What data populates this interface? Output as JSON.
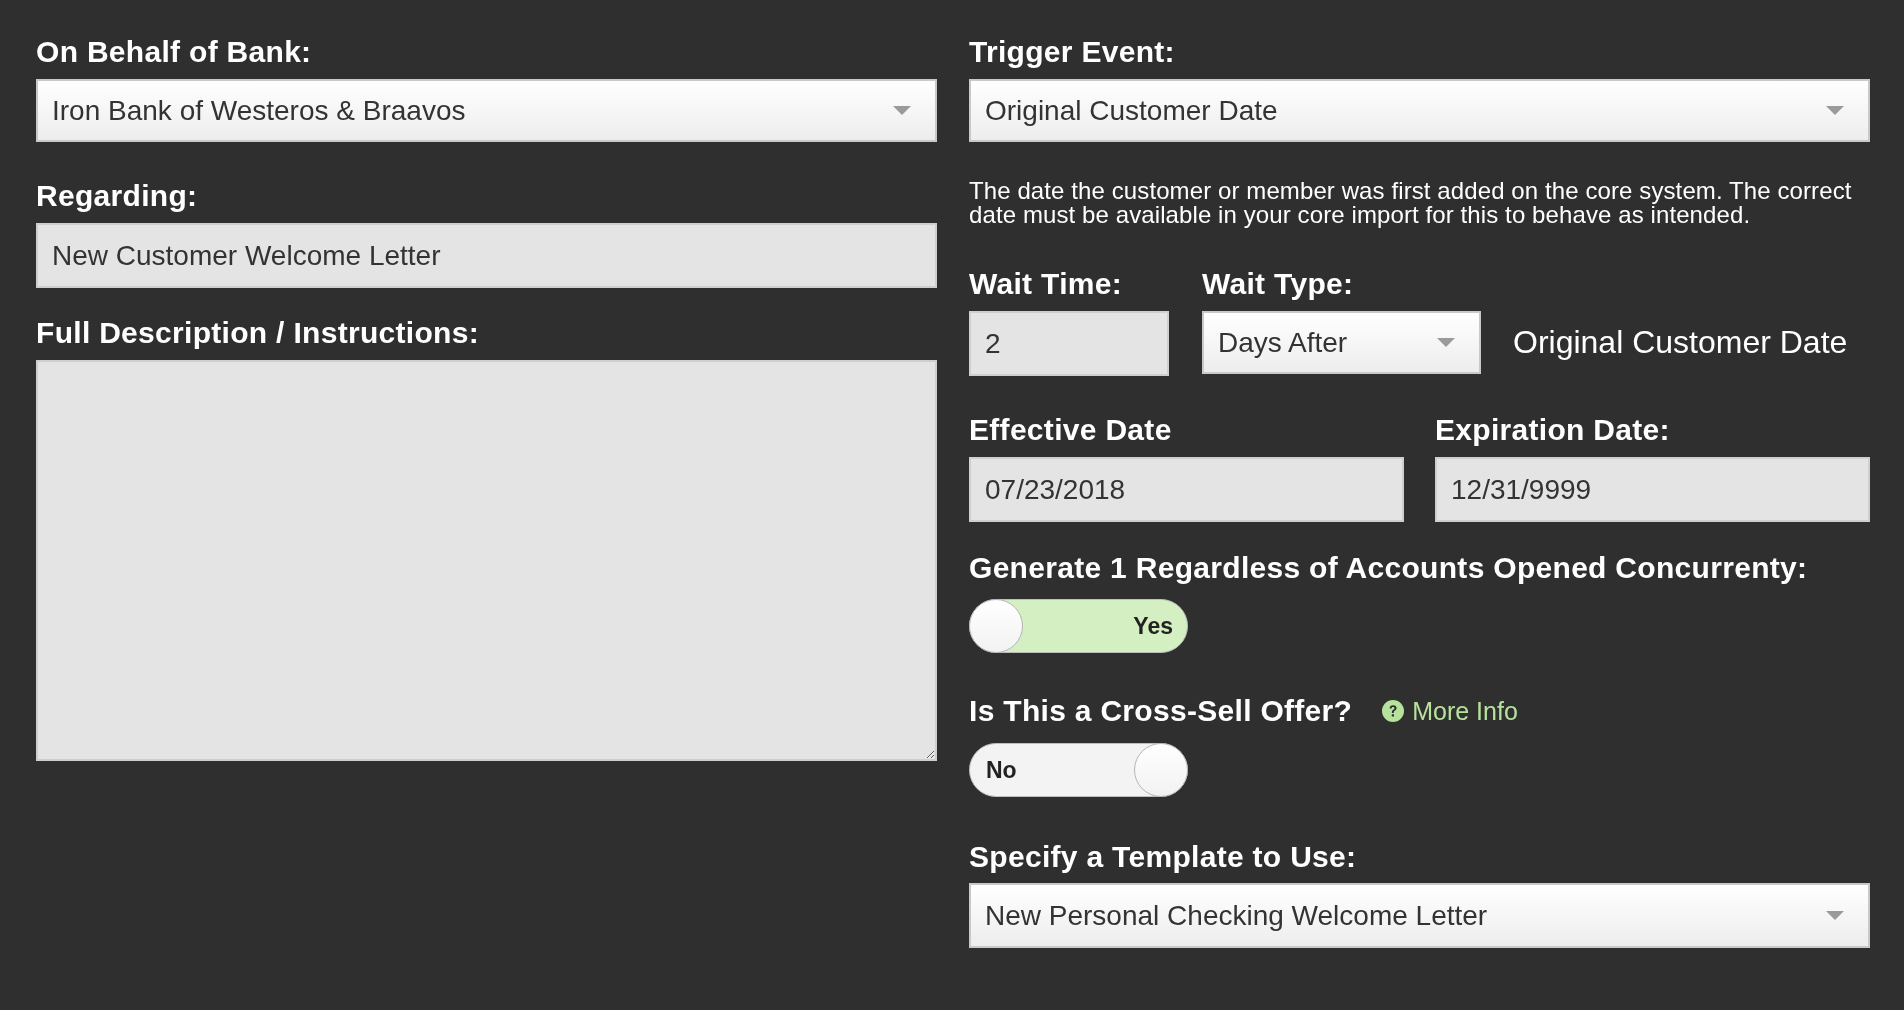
{
  "left": {
    "bank": {
      "label": "On Behalf of Bank:",
      "value": "Iron Bank of Westeros & Braavos"
    },
    "regarding": {
      "label": "Regarding:",
      "value": "New Customer Welcome Letter"
    },
    "description": {
      "label": "Full Description / Instructions:"
    }
  },
  "right": {
    "trigger_event": {
      "label": "Trigger Event:",
      "value": "Original Customer Date",
      "help": "The date the customer or member was first added on the core system. The correct date must be available in your core import for this to behave as intended."
    },
    "wait_time": {
      "label": "Wait Time:",
      "value": "2"
    },
    "wait_type": {
      "label": "Wait Type:",
      "value": "Days After"
    },
    "wait_reference": "Original Customer Date",
    "effective_date": {
      "label": "Effective Date",
      "value": "07/23/2018"
    },
    "expiration_date": {
      "label": "Expiration Date:",
      "value": "12/31/9999"
    },
    "generate_one": {
      "label": "Generate 1 Regardless of Accounts Opened Concurrenty:",
      "on": true,
      "state_text": "Yes"
    },
    "cross_sell": {
      "label": "Is This a Cross-Sell Offer?",
      "link": "More Info",
      "on": false,
      "state_text": "No"
    },
    "template": {
      "label": "Specify a Template to Use:",
      "value": "New Personal Checking Welcome Letter"
    }
  }
}
